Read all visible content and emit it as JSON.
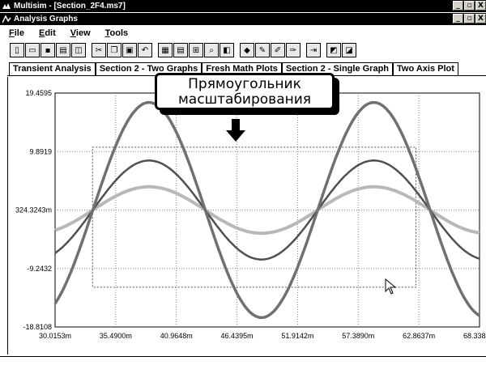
{
  "app": {
    "outer_title": "Multisim - [Section_2F4.ms7]",
    "inner_title": "Analysis Graphs",
    "window_buttons": [
      "_",
      "̸",
      "X"
    ]
  },
  "menu": {
    "items": [
      {
        "underline": "F",
        "rest": "ile"
      },
      {
        "underline": "E",
        "rest": "dit"
      },
      {
        "underline": "V",
        "rest": "iew"
      },
      {
        "underline": "T",
        "rest": "ools"
      }
    ]
  },
  "toolbar": {
    "icons": [
      "new-icon",
      "open-icon",
      "save-icon",
      "print-icon",
      "print-preview-icon",
      "cut-icon",
      "copy-icon",
      "paste-icon",
      "undo-icon",
      "grid-icon",
      "legend-icon",
      "cursors-icon",
      "zoom-icon",
      "zoom-full-icon",
      "color-icon",
      "pen-icon",
      "pen2-icon",
      "pen3-icon",
      "export-icon",
      "overlay-icon",
      "props-icon"
    ]
  },
  "tabs": [
    {
      "label": "Transient Analysis"
    },
    {
      "label": "Section 2 - Two Graphs"
    },
    {
      "label": "Fresh Math Plots"
    },
    {
      "label": "Section 2 - Single Graph"
    },
    {
      "label": "Two Axis Plot"
    }
  ],
  "callout": {
    "line1": "Прямоугольник",
    "line2": "масштабирования"
  },
  "chart_data": {
    "type": "line",
    "title": "",
    "xlabel": "",
    "ylabel": "",
    "x_ticks": [
      "30.0153m",
      "35.4900m",
      "40.9648m",
      "46.4395m",
      "51.9142m",
      "57.3890m",
      "62.8637m",
      "68.3384m"
    ],
    "y_ticks": [
      "19.4595",
      "9.8919",
      "324.3243m",
      "-9.2432",
      "-18.8108"
    ],
    "xlim": [
      30.0153,
      68.3384
    ],
    "ylim": [
      -18.8108,
      19.4595
    ],
    "grid": true,
    "series": [
      {
        "color": "#707070",
        "stroke": 3.5,
        "amplitude": 17.6,
        "offset": 0.324,
        "period": 20.3,
        "peak_x": 38.5
      },
      {
        "color": "#505050",
        "stroke": 2.5,
        "amplitude": 8.1,
        "offset": 0.324,
        "period": 20.3,
        "peak_x": 38.5
      },
      {
        "color": "#b8b8b8",
        "stroke": 4,
        "amplitude": 3.8,
        "offset": 0.324,
        "period": 20.3,
        "peak_x": 38.5
      }
    ],
    "zoom_rect": {
      "x0": 33.4,
      "x1": 62.6,
      "y0": -12.3,
      "y1": 10.6
    }
  }
}
